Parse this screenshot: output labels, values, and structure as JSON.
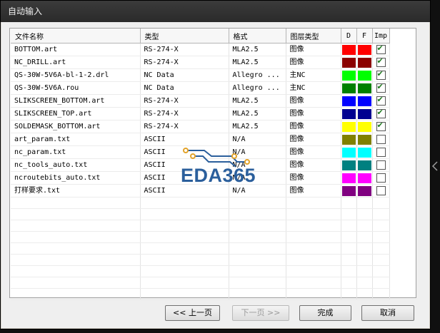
{
  "window": {
    "title": "自动输入"
  },
  "columns": [
    "文件名称",
    "类型",
    "格式",
    "图层类型",
    "D",
    "F",
    "Imp"
  ],
  "rows": [
    {
      "name": "BOTTOM.art",
      "type": "RS-274-X",
      "format": "MLA2.5",
      "layer": "图像",
      "d": "#ff0000",
      "f": "#ff0000",
      "imp": true
    },
    {
      "name": "NC_DRILL.art",
      "type": "RS-274-X",
      "format": "MLA2.5",
      "layer": "图像",
      "d": "#8b0000",
      "f": "#8b0000",
      "imp": true
    },
    {
      "name": "QS-30W-5V6A-bl-1-2.drl",
      "type": "NC Data",
      "format": "Allegro ...",
      "layer": "主NC",
      "d": "#00ff00",
      "f": "#00ff00",
      "imp": true
    },
    {
      "name": "QS-30W-5V6A.rou",
      "type": "NC Data",
      "format": "Allegro ...",
      "layer": "主NC",
      "d": "#008000",
      "f": "#008000",
      "imp": true
    },
    {
      "name": "SLIKSCREEN_BOTTOM.art",
      "type": "RS-274-X",
      "format": "MLA2.5",
      "layer": "图像",
      "d": "#0000ff",
      "f": "#0000ff",
      "imp": true
    },
    {
      "name": "SLIKSCREEN_TOP.art",
      "type": "RS-274-X",
      "format": "MLA2.5",
      "layer": "图像",
      "d": "#000090",
      "f": "#000090",
      "imp": true
    },
    {
      "name": "SOLDEMASK_BOTTOM.art",
      "type": "RS-274-X",
      "format": "MLA2.5",
      "layer": "图像",
      "d": "#ffff00",
      "f": "#ffff00",
      "imp": true
    },
    {
      "name": "art_param.txt",
      "type": "ASCII",
      "format": "N/A",
      "layer": "图像",
      "d": "#808000",
      "f": "#808000",
      "imp": false
    },
    {
      "name": "nc_param.txt",
      "type": "ASCII",
      "format": "N/A",
      "layer": "图像",
      "d": "#00ffff",
      "f": "#00ffff",
      "imp": false
    },
    {
      "name": "nc_tools_auto.txt",
      "type": "ASCII",
      "format": "N/A",
      "layer": "图像",
      "d": "#008080",
      "f": "#008080",
      "imp": false
    },
    {
      "name": "ncroutebits_auto.txt",
      "type": "ASCII",
      "format": "N/A",
      "layer": "图像",
      "d": "#ff00ff",
      "f": "#ff00ff",
      "imp": false
    },
    {
      "name": "打样要求.txt",
      "type": "ASCII",
      "format": "N/A",
      "layer": "图像",
      "d": "#800080",
      "f": "#800080",
      "imp": false
    }
  ],
  "buttons": {
    "prev": "<< 上一页",
    "next": "下一页 >>",
    "finish": "完成",
    "cancel": "取消"
  },
  "watermark": {
    "text": "EDA365"
  }
}
